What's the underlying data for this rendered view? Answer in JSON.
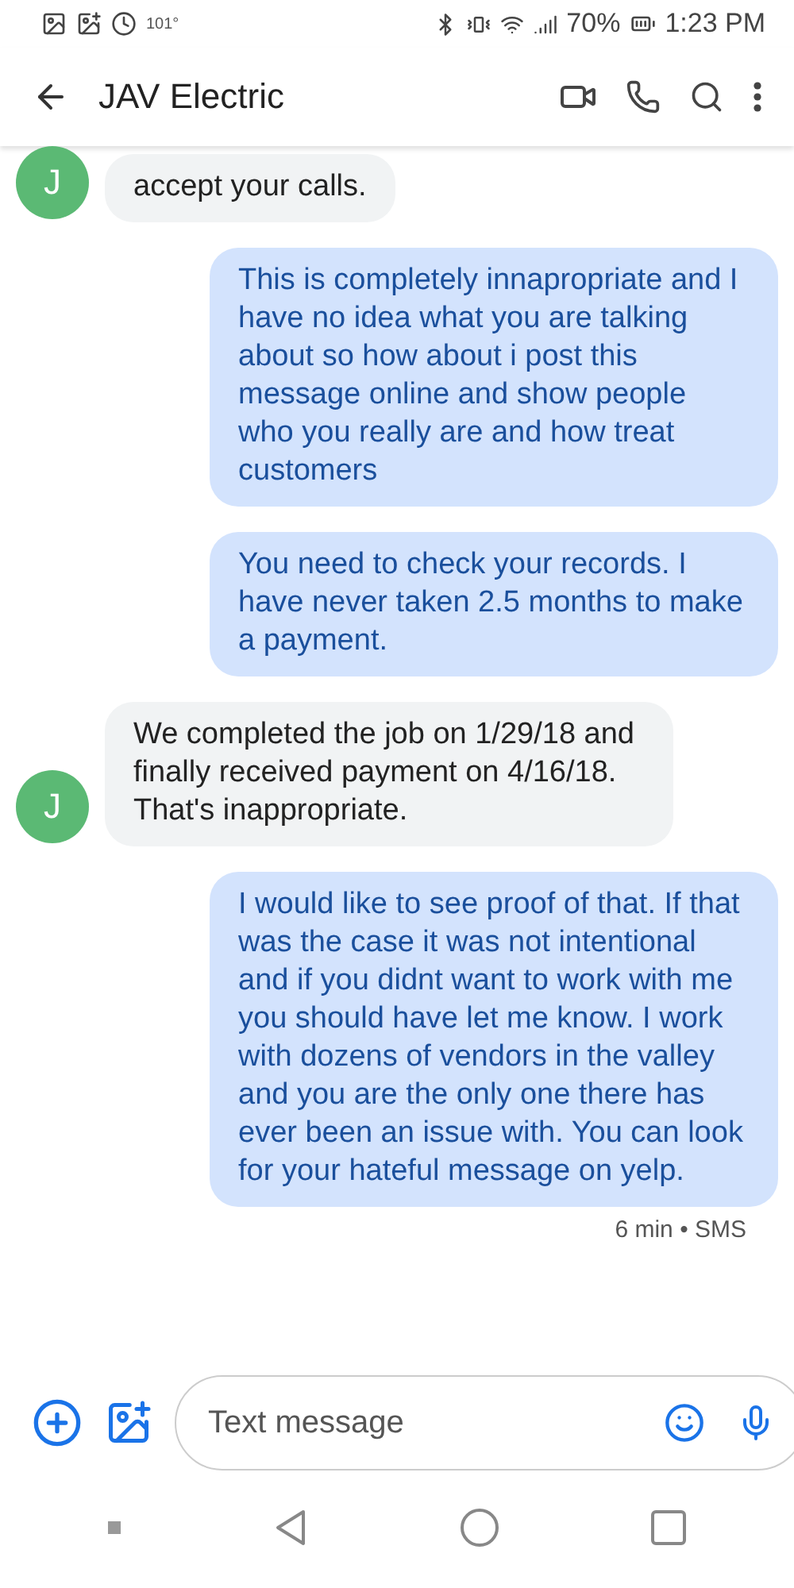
{
  "status_bar": {
    "temperature": "101°",
    "battery": "70%",
    "time": "1:23 PM"
  },
  "header": {
    "title": "JAV Electric"
  },
  "messages": [
    {
      "kind": "incoming",
      "avatar": "J",
      "text": "accept your calls."
    },
    {
      "kind": "outgoing",
      "text": "This is completely innapropriate and I have no idea what you are talking about so how about i post this message online and show people who you really are and how treat customers"
    },
    {
      "kind": "outgoing",
      "text": "You need to check your records. I have never taken 2.5 months to make a payment."
    },
    {
      "kind": "incoming",
      "avatar": "J",
      "text": "We completed the job on 1/29/18 and finally received payment on 4/16/18. That's inappropriate."
    },
    {
      "kind": "outgoing",
      "text": "I would like to see proof of that. If that was the case it was not intentional and if you didnt want to work with me you should have let me know. I work with dozens of vendors in the valley and you are the only one there has ever been an issue with. You can look for your hateful message on yelp."
    }
  ],
  "timestamp": "6 min • SMS",
  "compose": {
    "placeholder": "Text message"
  }
}
